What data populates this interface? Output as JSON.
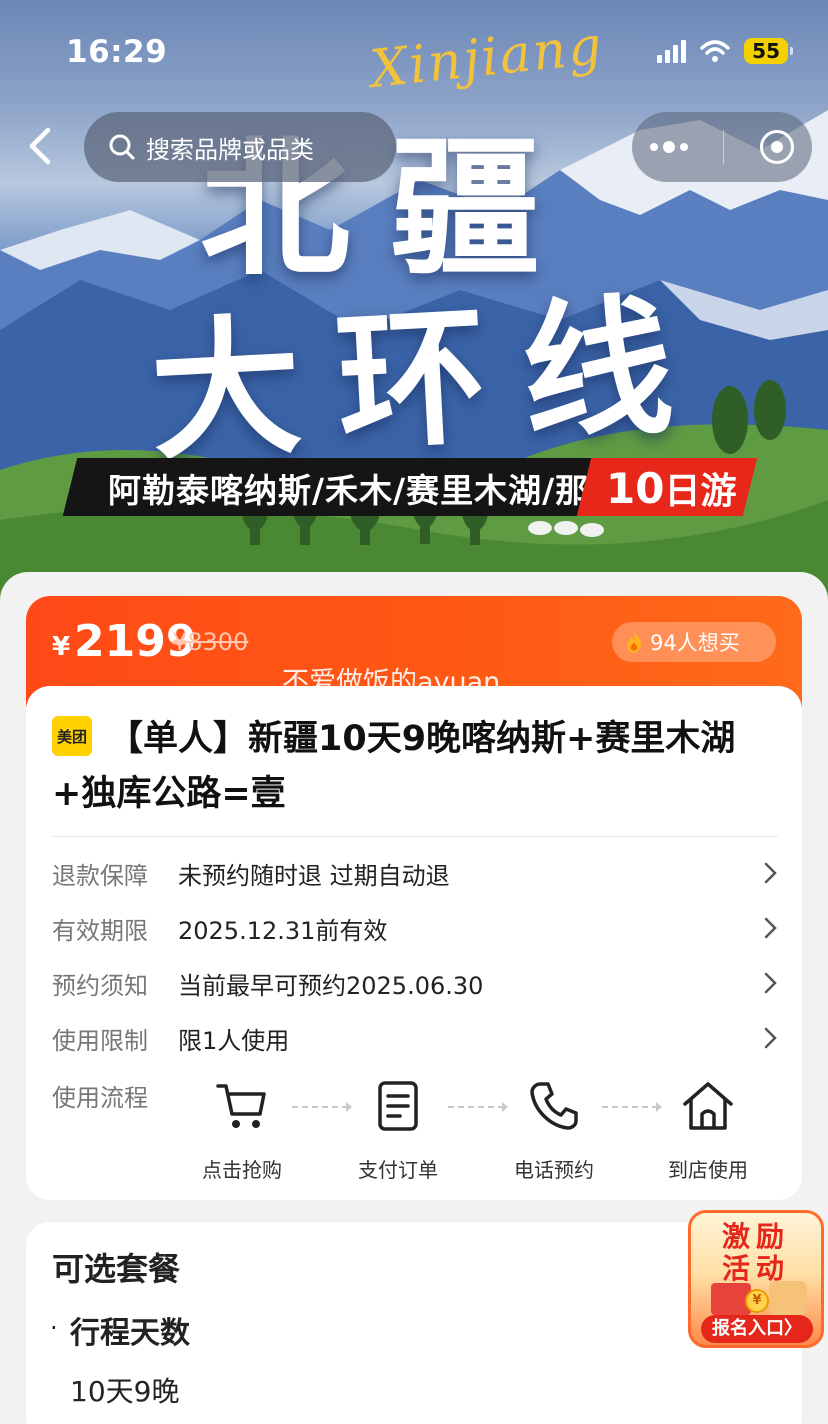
{
  "status_bar": {
    "time": "16:29",
    "battery": "55",
    "icons": [
      "signal-icon",
      "wifi-icon",
      "battery-icon"
    ]
  },
  "nav": {
    "search_placeholder": "搜索品牌或品类",
    "icons": [
      "back-arrow-icon",
      "search-icon",
      "more-dots-icon",
      "target-icon"
    ]
  },
  "hero": {
    "script_title": "Xinjiang",
    "title_line1": "北疆",
    "title_line2": "大环线",
    "route": "阿勒泰喀纳斯/禾木/赛里木湖/那拉提",
    "days_num": "10",
    "days_unit": "日游"
  },
  "price": {
    "currency": "¥",
    "current": "2199",
    "original": "¥8300",
    "want_count": "94人想买",
    "watermark": "不爱做饭的ayuan"
  },
  "product": {
    "badge": "美团",
    "title": "【单人】新疆10天9晚喀纳斯+赛里木湖+独库公路=壹"
  },
  "info_rows": [
    {
      "label": "退款保障",
      "value": "未预约随时退 过期自动退"
    },
    {
      "label": "有效期限",
      "value": "2025.12.31前有效"
    },
    {
      "label": "预约须知",
      "value": "当前最早可预约2025.06.30"
    },
    {
      "label": "使用限制",
      "value": "限1人使用"
    }
  ],
  "flow": {
    "label": "使用流程",
    "steps": [
      {
        "label": "点击抢购",
        "icon": "cart-icon"
      },
      {
        "label": "支付订单",
        "icon": "document-icon"
      },
      {
        "label": "电话预约",
        "icon": "phone-icon"
      },
      {
        "label": "到店使用",
        "icon": "home-icon"
      }
    ]
  },
  "packages": {
    "title": "可选套餐",
    "bullet": "·",
    "subtitle": "行程天数",
    "option": "10天9晚"
  },
  "promo": {
    "line1": "激励",
    "line2": "活动",
    "coin": "¥",
    "cta": "报名入口",
    "cta_arrow": "〉"
  },
  "colors": {
    "price_bar": "#ff4a17",
    "badge_yellow": "#ffd100",
    "promo_red": "#e5261a"
  }
}
